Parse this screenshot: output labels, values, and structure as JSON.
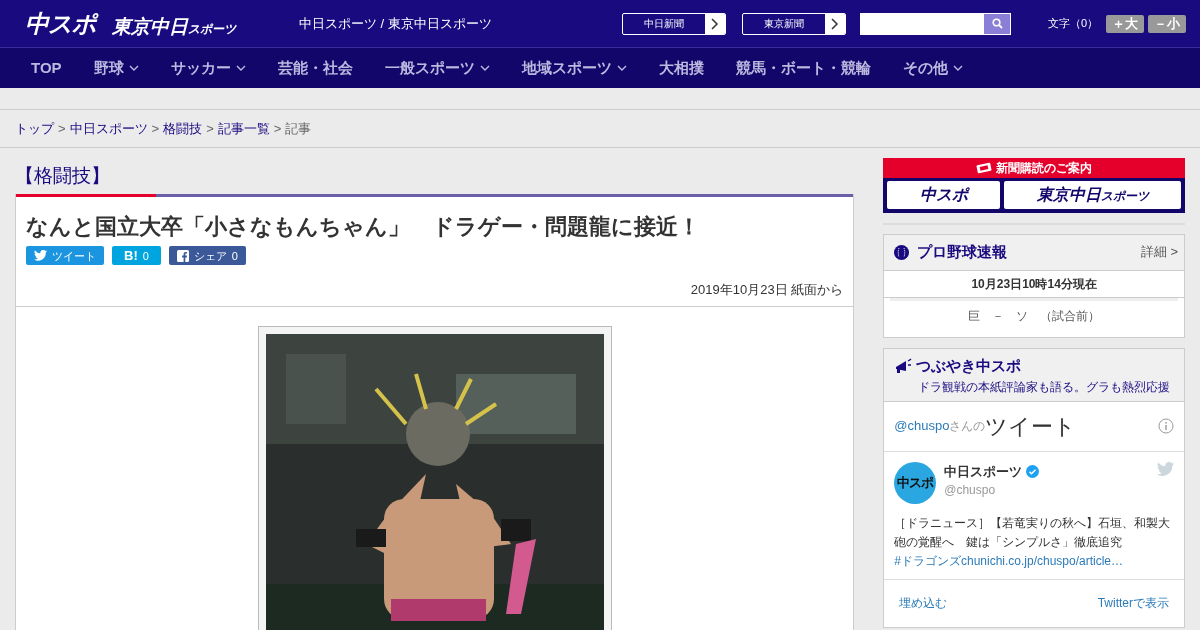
{
  "header": {
    "logo_main": "中スポ",
    "logo_sub": "東京中日",
    "logo_sub_small": "スポーツ",
    "site_title": "中日スポーツ / 東京中日スポーツ",
    "paper_links": [
      {
        "label": "中日新聞"
      },
      {
        "label": "東京新聞"
      }
    ],
    "font_size": {
      "label": "文字（0）",
      "buttons": [
        {
          "label": "＋大"
        },
        {
          "label": "－小"
        }
      ]
    }
  },
  "nav": [
    {
      "label": "TOP",
      "dropdown": false
    },
    {
      "label": "野球",
      "dropdown": true
    },
    {
      "label": "サッカー",
      "dropdown": true
    },
    {
      "label": "芸能・社会",
      "dropdown": false
    },
    {
      "label": "一般スポーツ",
      "dropdown": true
    },
    {
      "label": "地域スポーツ",
      "dropdown": true
    },
    {
      "label": "大相撲",
      "dropdown": false
    },
    {
      "label": "競馬・ボート・競輪",
      "dropdown": false
    },
    {
      "label": "その他",
      "dropdown": true
    }
  ],
  "breadcrumb": [
    {
      "kind": "link",
      "label": "トップ"
    },
    {
      "kind": "separator",
      "label": ">"
    },
    {
      "kind": "link",
      "label": "中日スポーツ"
    },
    {
      "kind": "separator",
      "label": ">"
    },
    {
      "kind": "link",
      "label": "格闘技"
    },
    {
      "kind": "separator",
      "label": ">"
    },
    {
      "kind": "link",
      "label": "記事一覧"
    },
    {
      "kind": "separator",
      "label": ">"
    },
    {
      "kind": "current",
      "label": "記事"
    }
  ],
  "article": {
    "category": "【格闘技】",
    "title": "なんと国立大卒「小さなもんちゃん」　ドラゲー・問題龍に接近！",
    "share": [
      {
        "kind": "twitter",
        "label": "ツイート"
      },
      {
        "kind": "hatena",
        "label": "B!",
        "count": "0"
      },
      {
        "kind": "facebook",
        "label": "シェア",
        "count": "0"
      }
    ],
    "date": "2019年10月23日 紙面から"
  },
  "sidebar": {
    "subscribe": {
      "title": "新聞購読のご案内",
      "buttons": [
        {
          "label": "中スポ"
        },
        {
          "label": "東京中日",
          "small": "スポーツ"
        }
      ]
    },
    "baseball": {
      "title": "プロ野球速報",
      "more": "詳細 >",
      "updated": "10月23日10時14分現在",
      "games": [
        {
          "text": "巨　－　ソ　（試合前）"
        }
      ]
    },
    "tweets": {
      "title": "つぶやき中スポ",
      "subtitle": "ドラ観戦の本紙評論家も語る。グラも熱烈応援",
      "handle_link": "@chuspo",
      "handle_suffix": "さんの",
      "heading": "ツイート",
      "tweet": {
        "avatar": "中スポ",
        "name": "中日スポーツ",
        "verified": true,
        "handle": "@chuspo",
        "text": "［ドラニュース］【若竜実りの秋へ】石垣、和製大砲の覚醒へ　鍵は「シンプルさ」徹底追究",
        "hashtag": "#ドラゴンズ",
        "url": "chunichi.co.jp/chuspo/article…"
      },
      "footer": [
        "埋め込む",
        "Twitterで表示"
      ]
    }
  }
}
